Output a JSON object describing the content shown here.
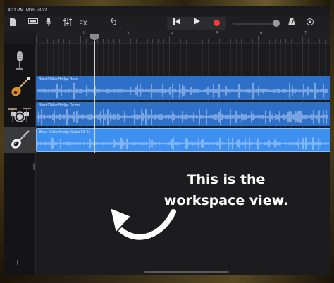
{
  "status_bar": {
    "time": "4:31 PM",
    "date": "Mon Jul 22"
  },
  "toolbar": {
    "icons": [
      "document-icon",
      "view-toggle-icon",
      "microphone-icon",
      "mixer-icon"
    ],
    "fx_label": "FX",
    "transport": [
      "rewind-icon",
      "play-icon",
      "record-icon"
    ]
  },
  "ruler": {
    "numbers": [
      "1",
      "2",
      "3",
      "4",
      "5",
      "6",
      "7"
    ]
  },
  "tracks": [
    {
      "name": "",
      "instrument": "microphone"
    },
    {
      "name": "Blast Chiller Bridge Bass",
      "instrument": "bass"
    },
    {
      "name": "Blast Chiller Bridge Drums",
      "instrument": "drums"
    },
    {
      "name": "Blast Chiller Bridge Guitar Fill 01",
      "instrument": "guitar"
    }
  ],
  "annotation": {
    "line1": "This is the",
    "line2": "workspace view."
  },
  "colors": {
    "region": "#2e6fc8",
    "region_selected": "#3d8ff0",
    "record": "#f23b3b"
  }
}
